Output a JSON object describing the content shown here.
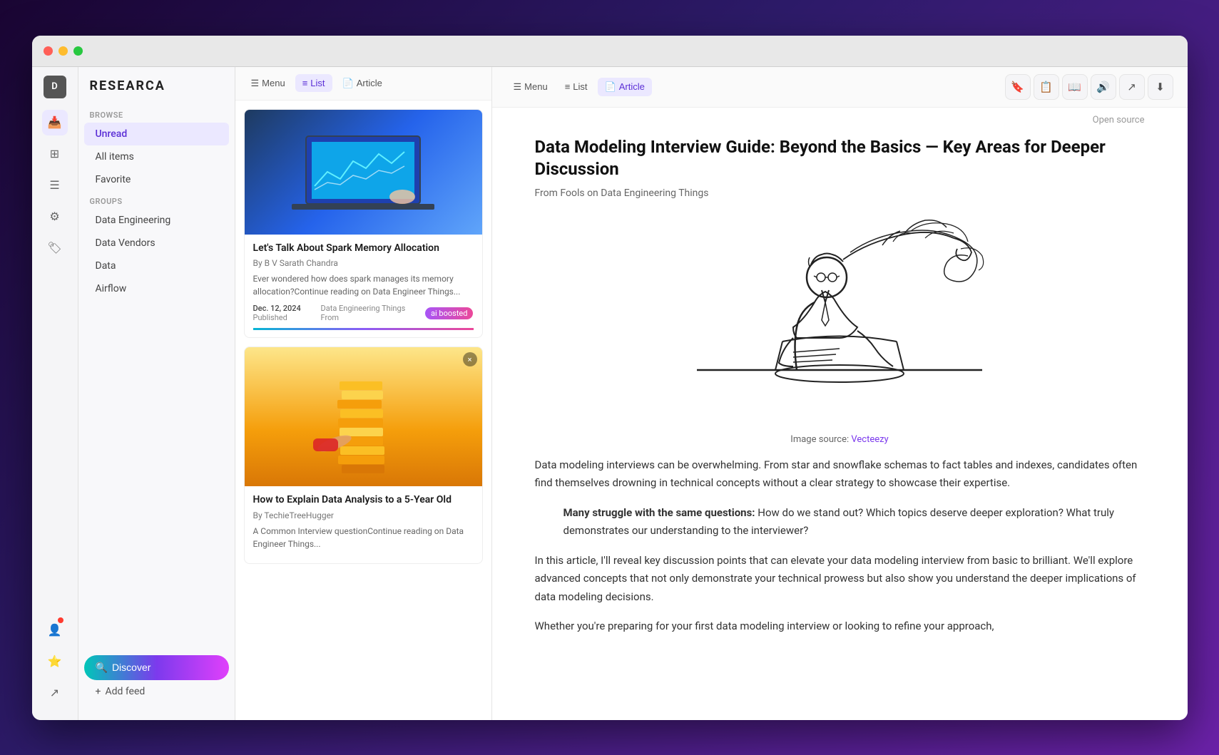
{
  "app": {
    "name": "RESEARCA",
    "avatar_label": "D"
  },
  "titlebar": {
    "traffic_lights": [
      "red",
      "yellow",
      "green"
    ]
  },
  "toolbar_left": {
    "menu_label": "Menu",
    "list_label": "List",
    "article_label": "Article"
  },
  "toolbar_right": {
    "menu_label": "Menu",
    "list_label": "List",
    "article_label": "Article"
  },
  "sidebar": {
    "browse_label": "BROWSE",
    "groups_label": "GROUPS",
    "nav_items": [
      {
        "label": "Unread",
        "active": true
      },
      {
        "label": "All items",
        "active": false
      },
      {
        "label": "Favorite",
        "active": false
      }
    ],
    "group_items": [
      {
        "label": "Data Engineering"
      },
      {
        "label": "Data Vendors"
      },
      {
        "label": "Data"
      },
      {
        "label": "Airflow"
      }
    ],
    "discover_btn": "Discover",
    "add_feed_btn": "Add feed"
  },
  "articles": [
    {
      "title": "Let's Talk About Spark Memory Allocation",
      "author": "By B V Sarath Chandra",
      "excerpt": "Ever wondered how does spark manages its memory allocation?Continue reading on Data Engineer Things...",
      "date": "Dec. 12, 2024",
      "status": "Published",
      "source_label": "Data Engineering Things",
      "source_from": "From",
      "ai_badge": "ai boosted"
    },
    {
      "title": "How to Explain Data Analysis to a 5-Year Old",
      "author": "By TechieTreeHugger",
      "excerpt": "A Common Interview questionContinue reading on Data Engineer Things..."
    }
  ],
  "reader": {
    "title": "Data Modeling Interview Guide: Beyond the Basics — Key Areas for Deeper Discussion",
    "source": "From Fools on Data Engineering Things",
    "open_source": "Open source",
    "image_caption_text": "Image source:",
    "image_caption_link": "Vecteezy",
    "paragraphs": [
      "Data modeling interviews can be overwhelming. From star and snowflake schemas to fact tables and indexes, candidates often find themselves drowning in technical concepts without a clear strategy to showcase their expertise.",
      "Many struggle with the same questions: How do we stand out? Which topics deserve deeper exploration? What truly demonstrates our understanding to the interviewer?",
      "In this article, I'll reveal key discussion points that can elevate your data modeling interview from basic to brilliant. We'll explore advanced concepts that not only demonstrate your technical prowess but also show you understand the deeper implications of data modeling decisions.",
      "Whether you're preparing for your first data modeling interview or looking to refine your approach,"
    ],
    "callout_bold": "Many struggle with the same questions:",
    "callout_rest": " How do we stand out? Which topics deserve deeper exploration? What truly demonstrates our understanding to the interviewer?"
  },
  "icons": {
    "menu": "≡",
    "list": "≡",
    "article": "📄",
    "bookmark": "🔖",
    "document": "📋",
    "book": "📖",
    "speaker": "🔊",
    "share": "↗",
    "download": "⬇",
    "search": "🔍",
    "settings": "⚙",
    "inbox": "📥",
    "layers": "⊞",
    "filter": "≡",
    "tag": "🏷",
    "plus": "+",
    "star": "★",
    "person": "👤",
    "close": "×"
  }
}
